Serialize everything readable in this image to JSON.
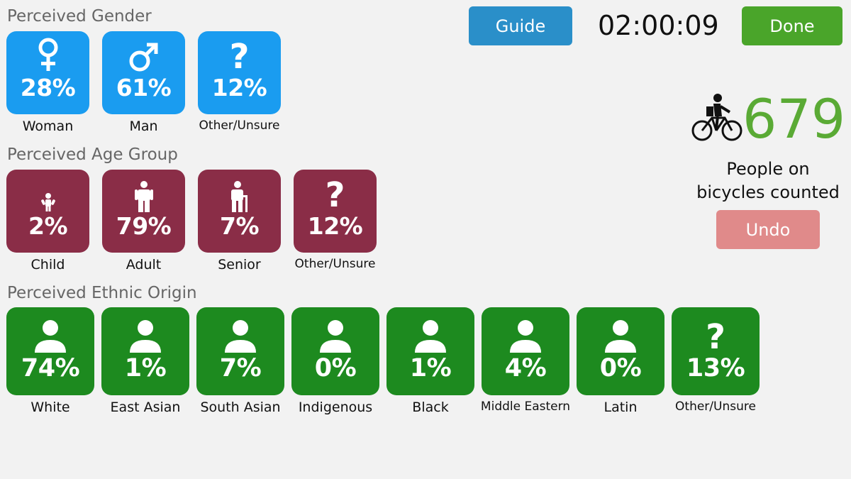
{
  "header": {
    "guide_label": "Guide",
    "timer": "02:00:09",
    "done_label": "Done"
  },
  "counter": {
    "value": "679",
    "label_line1": "People on",
    "label_line2": "bicycles counted",
    "undo_label": "Undo",
    "icon": "cyclist-icon"
  },
  "gender": {
    "title": "Perceived Gender",
    "items": [
      {
        "icon": "female-icon",
        "pct": "28%",
        "label": "Woman"
      },
      {
        "icon": "male-icon",
        "pct": "61%",
        "label": "Man"
      },
      {
        "icon": "question-icon",
        "pct": "12%",
        "label": "Other/Unsure"
      }
    ]
  },
  "age": {
    "title": "Perceived Age Group",
    "items": [
      {
        "icon": "child-icon",
        "pct": "2%",
        "label": "Child"
      },
      {
        "icon": "adult-icon",
        "pct": "79%",
        "label": "Adult"
      },
      {
        "icon": "senior-icon",
        "pct": "7%",
        "label": "Senior"
      },
      {
        "icon": "question-icon",
        "pct": "12%",
        "label": "Other/Unsure"
      }
    ]
  },
  "ethnicity": {
    "title": "Perceived Ethnic Origin",
    "items": [
      {
        "icon": "person-icon",
        "pct": "74%",
        "label": "White"
      },
      {
        "icon": "person-icon",
        "pct": "1%",
        "label": "East Asian"
      },
      {
        "icon": "person-icon",
        "pct": "7%",
        "label": "South Asian"
      },
      {
        "icon": "person-icon",
        "pct": "0%",
        "label": "Indigenous"
      },
      {
        "icon": "person-icon",
        "pct": "1%",
        "label": "Black"
      },
      {
        "icon": "person-icon",
        "pct": "4%",
        "label": "Middle Eastern"
      },
      {
        "icon": "person-icon",
        "pct": "0%",
        "label": "Latin"
      },
      {
        "icon": "question-icon",
        "pct": "13%",
        "label": "Other/Unsure"
      }
    ]
  },
  "colors": {
    "gender": "#1a9cf0",
    "age": "#8a2d47",
    "ethnicity": "#1d8a1f",
    "guide": "#2a8fc9",
    "done": "#4aa52a",
    "undo": "#e08a8a",
    "count": "#5aaa35"
  }
}
